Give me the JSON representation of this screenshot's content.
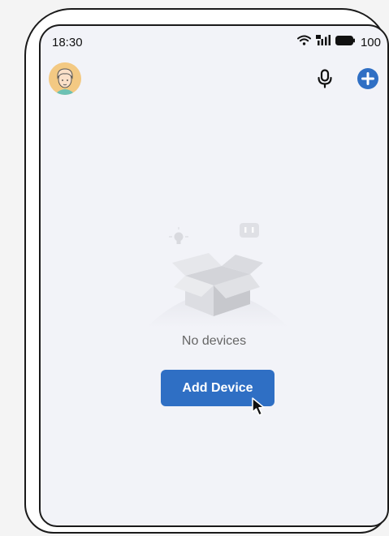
{
  "status_bar": {
    "time": "18:30",
    "battery": "100",
    "wifi_icon": "wifi-icon",
    "signal_icon": "signal-icon",
    "battery_icon": "battery-icon"
  },
  "toolbar": {
    "avatar_icon": "avatar-icon",
    "mic_icon": "microphone-icon",
    "add_icon": "plus-circle-icon"
  },
  "empty_state": {
    "message": "No devices",
    "illustration_icon": "empty-box-icon"
  },
  "actions": {
    "add_device_label": "Add Device"
  },
  "colors": {
    "accent": "#2f6fc4",
    "screen_bg": "#f2f3f8",
    "text_muted": "#666666"
  }
}
